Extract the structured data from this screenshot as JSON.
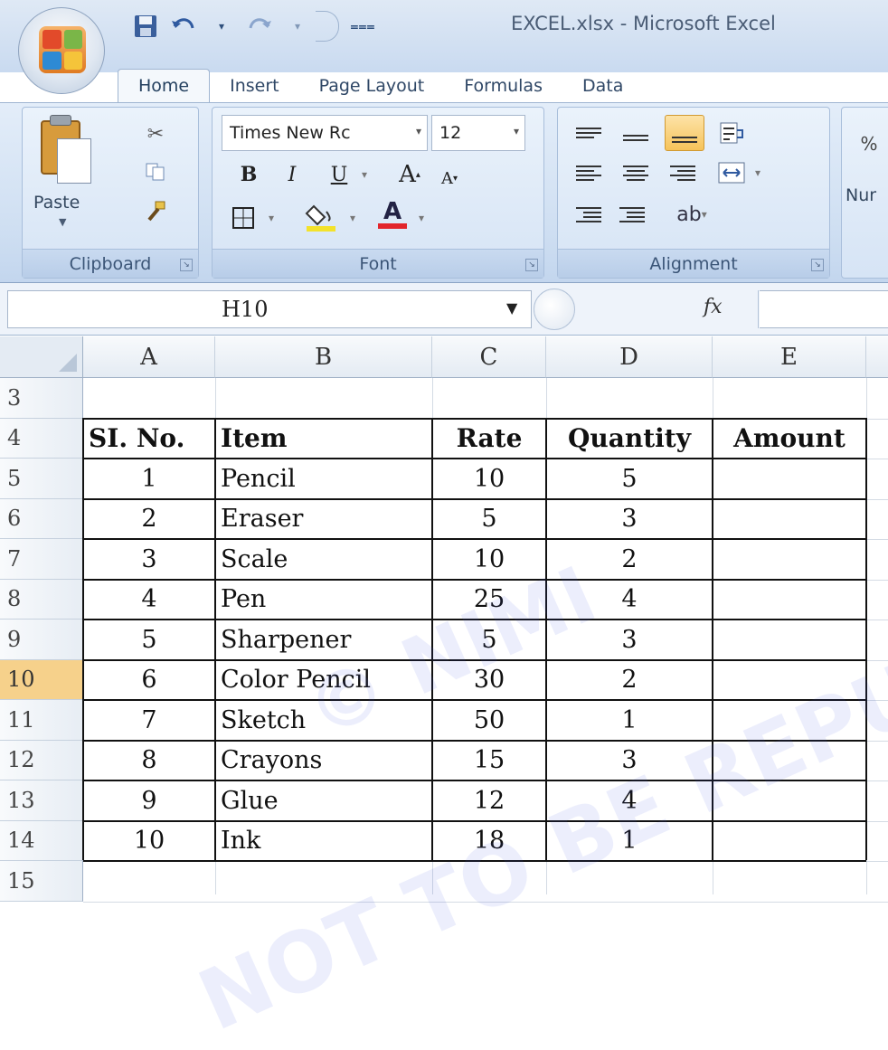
{
  "window": {
    "title": "EXCEL.xlsx - Microsoft Excel"
  },
  "quick_access": {
    "save_icon": "save-icon",
    "undo_icon": "undo-icon",
    "redo_icon": "redo-icon",
    "customize_icon": "customize-icon"
  },
  "tabs": [
    {
      "label": "Home",
      "active": true
    },
    {
      "label": "Insert"
    },
    {
      "label": "Page Layout"
    },
    {
      "label": "Formulas"
    },
    {
      "label": "Data"
    }
  ],
  "ribbon": {
    "clipboard": {
      "label": "Clipboard",
      "paste_label": "Paste"
    },
    "font": {
      "label": "Font",
      "font_name": "Times New Rc",
      "font_size": "12",
      "bold": "B",
      "italic": "I",
      "underline": "U",
      "grow": "A",
      "shrink": "A"
    },
    "alignment": {
      "label": "Alignment"
    },
    "number": {
      "label": "Nur"
    }
  },
  "formula_bar": {
    "name_box": "H10",
    "fx": "fx",
    "formula": ""
  },
  "sheet": {
    "columns": [
      "A",
      "B",
      "C",
      "D",
      "E"
    ],
    "row_numbers": [
      "3",
      "4",
      "5",
      "6",
      "7",
      "8",
      "9",
      "10",
      "11",
      "12",
      "13",
      "14",
      "15"
    ],
    "selected_row": "10",
    "header": {
      "sl": "SI. No.",
      "item": "Item",
      "rate": "Rate",
      "quantity": "Quantity",
      "amount": "Amount"
    },
    "rows": [
      {
        "sl": "1",
        "item": "Pencil",
        "rate": "10",
        "qty": "5",
        "amount": ""
      },
      {
        "sl": "2",
        "item": "Eraser",
        "rate": "5",
        "qty": "3",
        "amount": ""
      },
      {
        "sl": "3",
        "item": "Scale",
        "rate": "10",
        "qty": "2",
        "amount": ""
      },
      {
        "sl": "4",
        "item": "Pen",
        "rate": "25",
        "qty": "4",
        "amount": ""
      },
      {
        "sl": "5",
        "item": "Sharpener",
        "rate": "5",
        "qty": "3",
        "amount": ""
      },
      {
        "sl": "6",
        "item": "Color Pencil",
        "rate": "30",
        "qty": "2",
        "amount": ""
      },
      {
        "sl": "7",
        "item": "Sketch",
        "rate": "50",
        "qty": "1",
        "amount": ""
      },
      {
        "sl": "8",
        "item": "Crayons",
        "rate": "15",
        "qty": "3",
        "amount": ""
      },
      {
        "sl": "9",
        "item": "Glue",
        "rate": "12",
        "qty": "4",
        "amount": ""
      },
      {
        "sl": "10",
        "item": "Ink",
        "rate": "18",
        "qty": "1",
        "amount": ""
      }
    ]
  },
  "watermark": {
    "line1": "© NIMI",
    "line2": "NOT TO BE REPUBLISHED"
  },
  "colors": {
    "selected_row_header": "#f6d18b",
    "ribbon": "#d6e4f5",
    "grid_line": "#d4dbe4"
  }
}
